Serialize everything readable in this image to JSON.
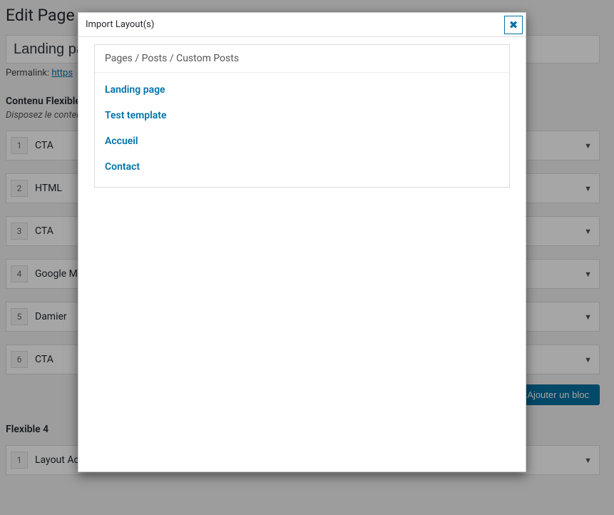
{
  "page": {
    "title": "Edit Page",
    "titleInput": "Landing page",
    "permalinkLabel": "Permalink: ",
    "permalinkUrl": "https",
    "flexible": {
      "title": "Contenu Flexible",
      "desc": "Disposez le contenu",
      "blocks": [
        {
          "num": "1",
          "label": "CTA"
        },
        {
          "num": "2",
          "label": "HTML"
        },
        {
          "num": "3",
          "label": "CTA"
        },
        {
          "num": "4",
          "label": "Google Ma"
        },
        {
          "num": "5",
          "label": "Damier"
        },
        {
          "num": "6",
          "label": "CTA"
        }
      ],
      "addLabel": "Ajouter un bloc"
    },
    "flexible2": {
      "title": "Flexible 4",
      "blocks": [
        {
          "num": "1",
          "label": "Layout Action"
        }
      ]
    }
  },
  "modal": {
    "title": "Import Layout(s)",
    "panelHeader": "Pages / Posts / Custom Posts",
    "items": [
      "Landing page",
      "Test template",
      "Accueil",
      "Contact"
    ]
  }
}
